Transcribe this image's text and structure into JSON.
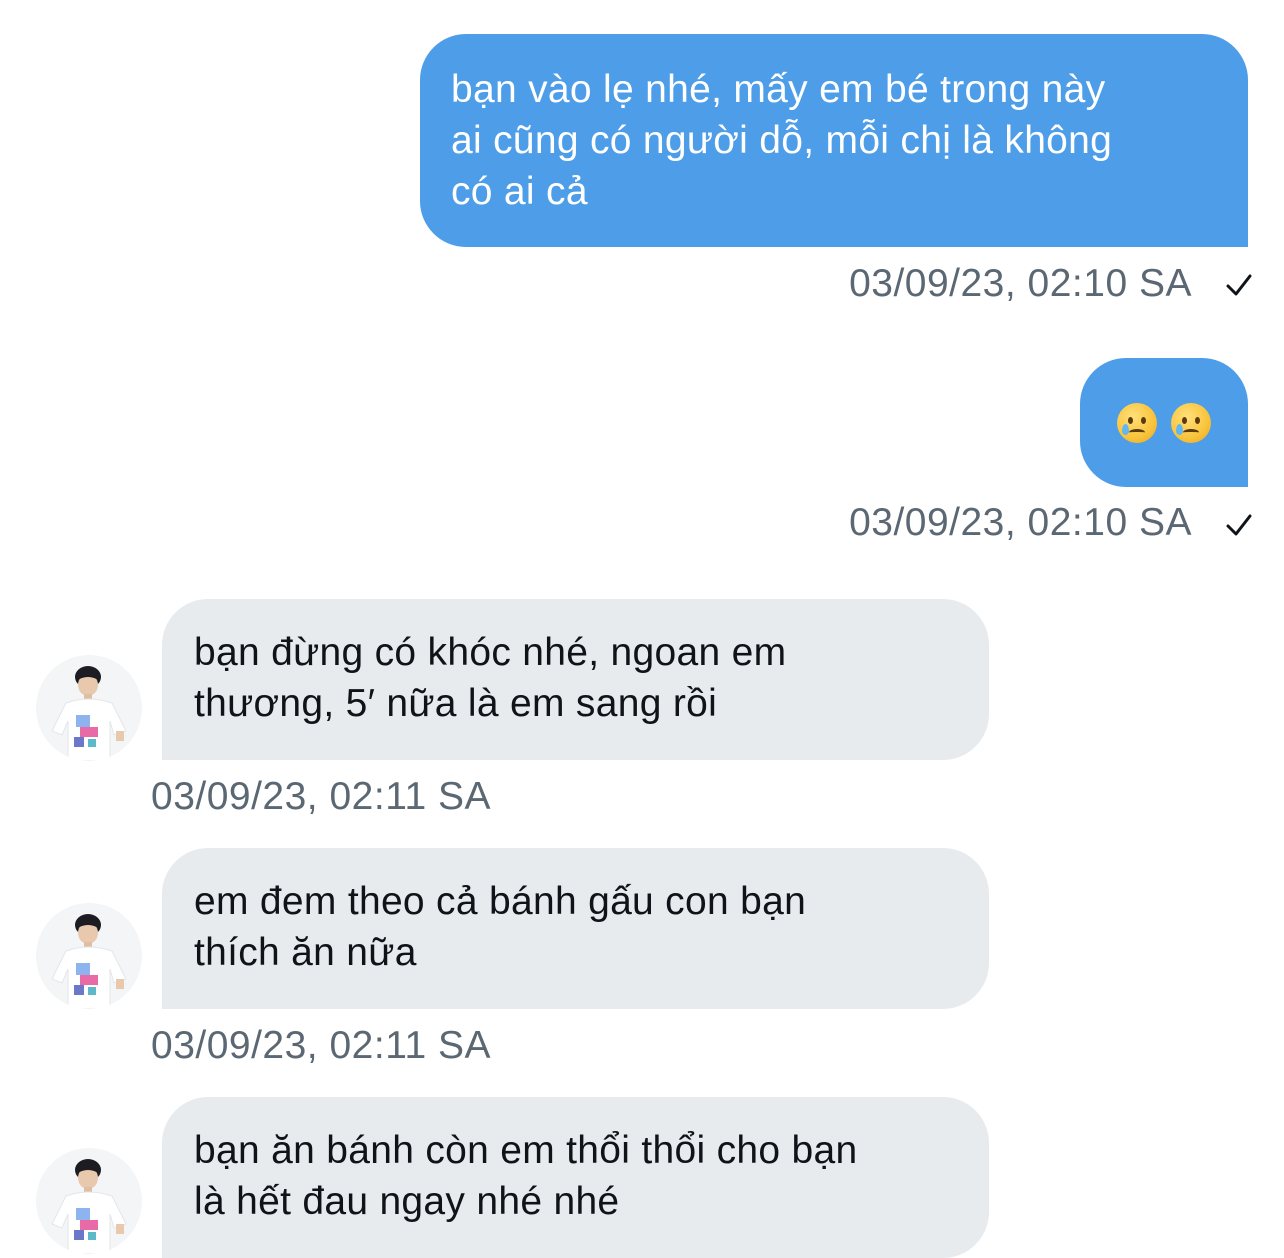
{
  "messages": [
    {
      "direction": "outgoing",
      "text": "bạn vào lẹ nhé, mấy em bé trong này\nai cũng có người dỗ, mỗi chị là không\ncó ai cả",
      "timestamp": "03/09/23, 02:10 SA",
      "status": "sent"
    },
    {
      "direction": "outgoing",
      "emoji": [
        "crying-face",
        "crying-face"
      ],
      "timestamp": "03/09/23, 02:10 SA",
      "status": "sent"
    },
    {
      "direction": "incoming",
      "text": "bạn đừng có khóc nhé, ngoan em\nthương, 5′ nữa là em sang rồi",
      "timestamp": "03/09/23, 02:11 SA"
    },
    {
      "direction": "incoming",
      "text": "em đem theo cả bánh gấu con bạn\nthích ăn nữa",
      "timestamp": "03/09/23, 02:11 SA"
    },
    {
      "direction": "incoming",
      "text": "bạn ăn bánh còn em thổi thổi cho bạn\nlà hết đau ngay nhé nhé"
    }
  ],
  "colors": {
    "outgoing_bubble": "#4d9de8",
    "incoming_bubble": "#e7ebee",
    "timestamp": "#5b6873",
    "incoming_text": "#0f1419",
    "outgoing_text": "#ffffff"
  },
  "icons": {
    "sent_status": "checkmark-icon",
    "avatar": "user-avatar",
    "emoji": "crying-face-emoji"
  }
}
